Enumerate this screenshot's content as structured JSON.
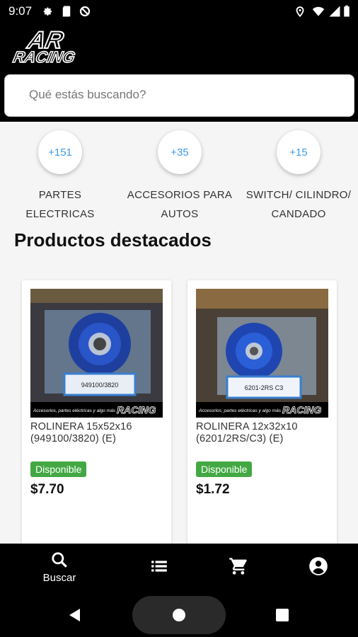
{
  "status_bar": {
    "time": "9:07"
  },
  "app": {
    "logo_text_top": "AR",
    "logo_text_bottom": "RACING"
  },
  "search": {
    "placeholder": "Qué estás buscando?"
  },
  "categories": [
    {
      "count": "+151",
      "label": "PARTES ELECTRICAS"
    },
    {
      "count": "+35",
      "label": "ACCESORIOS PARA AUTOS"
    },
    {
      "count": "+15",
      "label": "SWITCH/ CILINDRO/ CANDADO"
    }
  ],
  "section_title": "Productos destacados",
  "products": [
    {
      "name": "ROLINERA 15x52x16 (949100/3820) (E)",
      "status": "Disponible",
      "price": "$7.70",
      "box_label": "949100/3820",
      "banner": "Accesorios, partes eléctricas y algo más"
    },
    {
      "name": "ROLINERA 12x32x10 (6201/2RS/C3) (E)",
      "status": "Disponible",
      "price": "$1.72",
      "box_label": "6201-2RS C3",
      "banner": "Accesorios, partes eléctricas y algo más"
    }
  ],
  "bottom_nav": [
    {
      "label": "Buscar",
      "icon": "search-icon"
    },
    {
      "label": "",
      "icon": "list-icon"
    },
    {
      "label": "",
      "icon": "cart-icon"
    },
    {
      "label": "",
      "icon": "account-icon"
    }
  ],
  "colors": {
    "accent": "#3b9ae8",
    "available": "#43a843",
    "header": "#000000"
  }
}
